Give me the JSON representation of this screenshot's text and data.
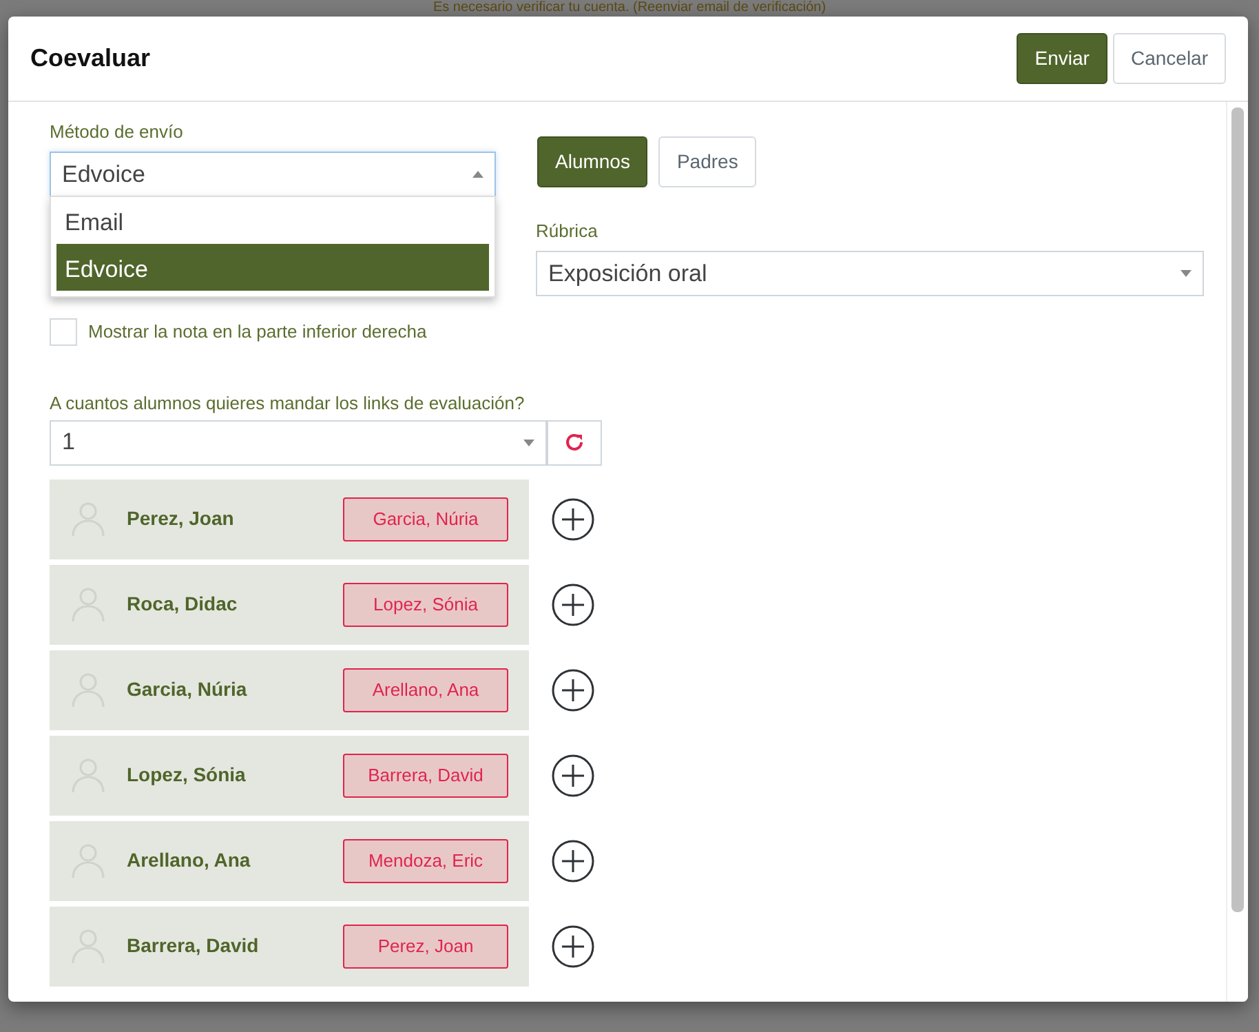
{
  "banner": {
    "text": "Es necesario verificar tu cuenta. (Reenviar email de verificación)"
  },
  "modal": {
    "title": "Coevaluar",
    "buttons": [
      {
        "label": "Enviar",
        "kind": "primary"
      },
      {
        "label": "Cancelar",
        "kind": "secondary"
      }
    ]
  },
  "send_method": {
    "label": "Método de envío",
    "value": "Edvoice",
    "expanded": true,
    "options": [
      {
        "label": "Email",
        "selected": false
      },
      {
        "label": "Edvoice",
        "selected": true
      }
    ]
  },
  "audience_tabs": [
    {
      "label": "Alumnos",
      "selected": true
    },
    {
      "label": "Padres",
      "selected": false
    }
  ],
  "rubric": {
    "label": "Rúbrica",
    "value": "Exposición oral"
  },
  "show_grade": {
    "label": "Mostrar la nota en la parte inferior derecha",
    "checked": false
  },
  "count": {
    "label": "A cuantos alumnos quieres mandar los links de evaluación?",
    "value": "1"
  },
  "pairs": [
    {
      "student": "Perez, Joan",
      "evaluates": [
        "Garcia, Núria"
      ]
    },
    {
      "student": "Roca, Didac",
      "evaluates": [
        "Lopez, Sónia"
      ]
    },
    {
      "student": "Garcia, Núria",
      "evaluates": [
        "Arellano, Ana"
      ]
    },
    {
      "student": "Lopez, Sónia",
      "evaluates": [
        "Barrera, David"
      ]
    },
    {
      "student": "Arellano, Ana",
      "evaluates": [
        "Mendoza, Eric"
      ]
    },
    {
      "student": "Barrera, David",
      "evaluates": [
        "Perez, Joan"
      ]
    }
  ]
}
